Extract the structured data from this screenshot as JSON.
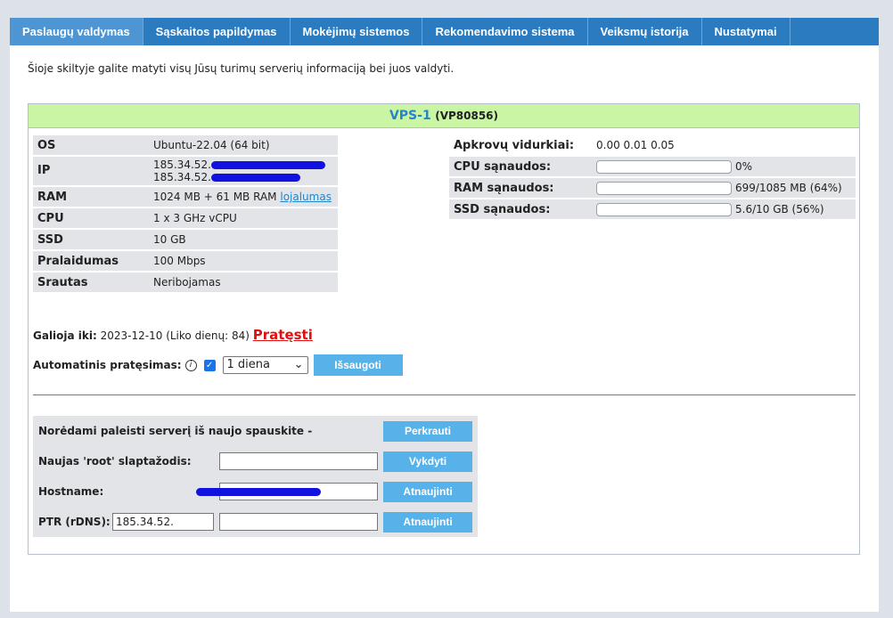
{
  "tabs": [
    {
      "label": "Paslaugų valdymas",
      "active": true
    },
    {
      "label": "Sąskaitos papildymas"
    },
    {
      "label": "Mokėjimų sistemos"
    },
    {
      "label": "Rekomendavimo sistema"
    },
    {
      "label": "Veiksmų istorija"
    },
    {
      "label": "Nustatymai"
    }
  ],
  "intro": "Šioje skiltyje galite matyti visų Jūsų turimų serverių informaciją bei juos valdyti.",
  "vps": {
    "name": "VPS-1",
    "code": "(VP80856)",
    "specs": [
      {
        "key": "OS",
        "value": "Ubuntu-22.04 (64 bit)"
      },
      {
        "key": "IP",
        "value1": "185.34.52.",
        "value2": "185.34.52."
      },
      {
        "key": "RAM",
        "value": "1024 MB + 61 MB RAM",
        "link": "lojalumas"
      },
      {
        "key": "CPU",
        "value": "1 x 3 GHz vCPU"
      },
      {
        "key": "SSD",
        "value": "10 GB"
      },
      {
        "key": "Pralaidumas",
        "value": "100 Mbps"
      },
      {
        "key": "Srautas",
        "value": "Neribojamas"
      }
    ],
    "load_label": "Apkrovų vidurkiai:",
    "load_value": "0.00 0.01 0.05",
    "usage": [
      {
        "key": "CPU sąnaudos:",
        "percent": 0,
        "text": "0%"
      },
      {
        "key": "RAM sąnaudos:",
        "percent": 64,
        "text": "699/1085 MB (64%)"
      },
      {
        "key": "SSD sąnaudos:",
        "percent": 56,
        "text": "5.6/10 GB (56%)"
      }
    ],
    "valid_label": "Galioja iki:",
    "valid_value": "2023-12-10 (Liko dienų: 84)",
    "renew_link": "Pratęsti",
    "auto_label": "Automatinis pratęsimas:",
    "auto_checked": true,
    "auto_select": "1 diena",
    "save_button": "Išsaugoti",
    "actions": {
      "restart_label": "Norėdami paleisti serverį iš naujo spauskite -",
      "restart_button": "Perkrauti",
      "root_label": "Naujas 'root' slaptažodis:",
      "root_button": "Vykdyti",
      "hostname_label": "Hostname:",
      "hostname_button": "Atnaujinti",
      "ptr_label": "PTR (rDNS):",
      "ptr_prefix": "185.34.52.",
      "ptr_button": "Atnaujinti"
    }
  }
}
